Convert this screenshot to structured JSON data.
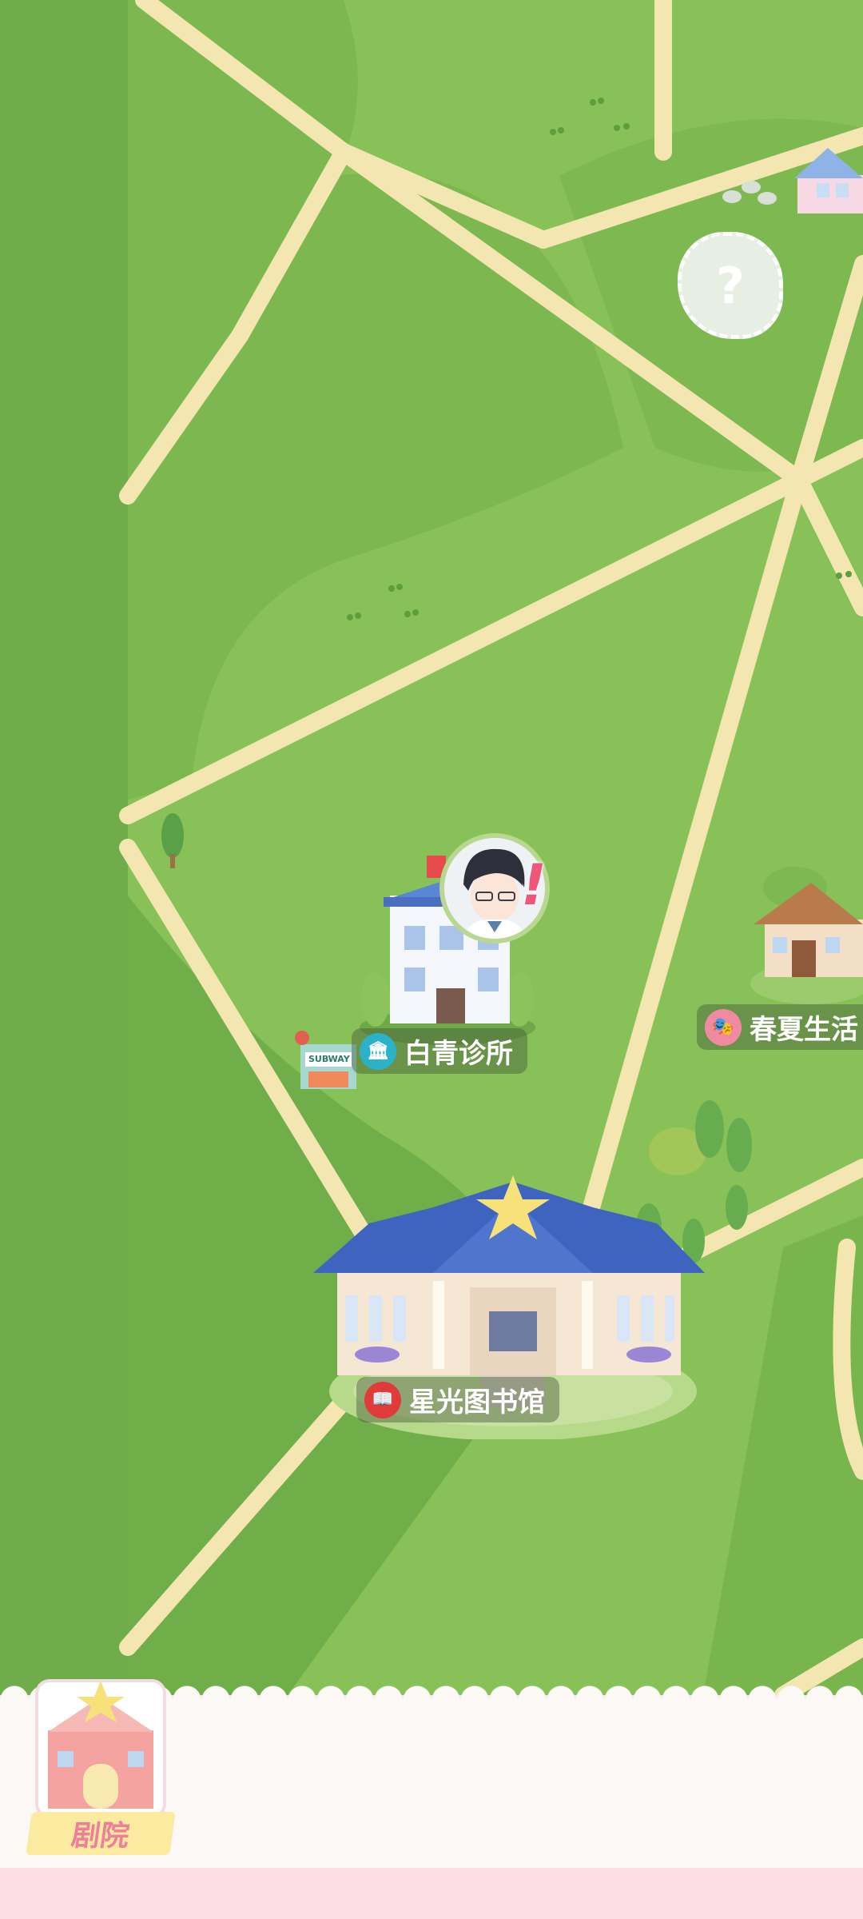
{
  "map": {
    "locations": {
      "clinic": {
        "name": "白青诊所",
        "badge_color": "#2bb2c9",
        "alert": "!"
      },
      "library": {
        "name": "星光图书馆",
        "badge_color": "#e03b3b"
      },
      "spring_summer": {
        "name": "春夏生活",
        "badge_color": "#f08aa0"
      },
      "unknown": {
        "mark": "?"
      },
      "subway_sign": "SUBWAY"
    }
  },
  "bottom_bar": {
    "theater_label": "剧院"
  },
  "colors": {
    "grass": "#88c157",
    "road": "#f4e6b0",
    "panel": "#fbf8f6",
    "pink_accent": "#ef7f98"
  }
}
